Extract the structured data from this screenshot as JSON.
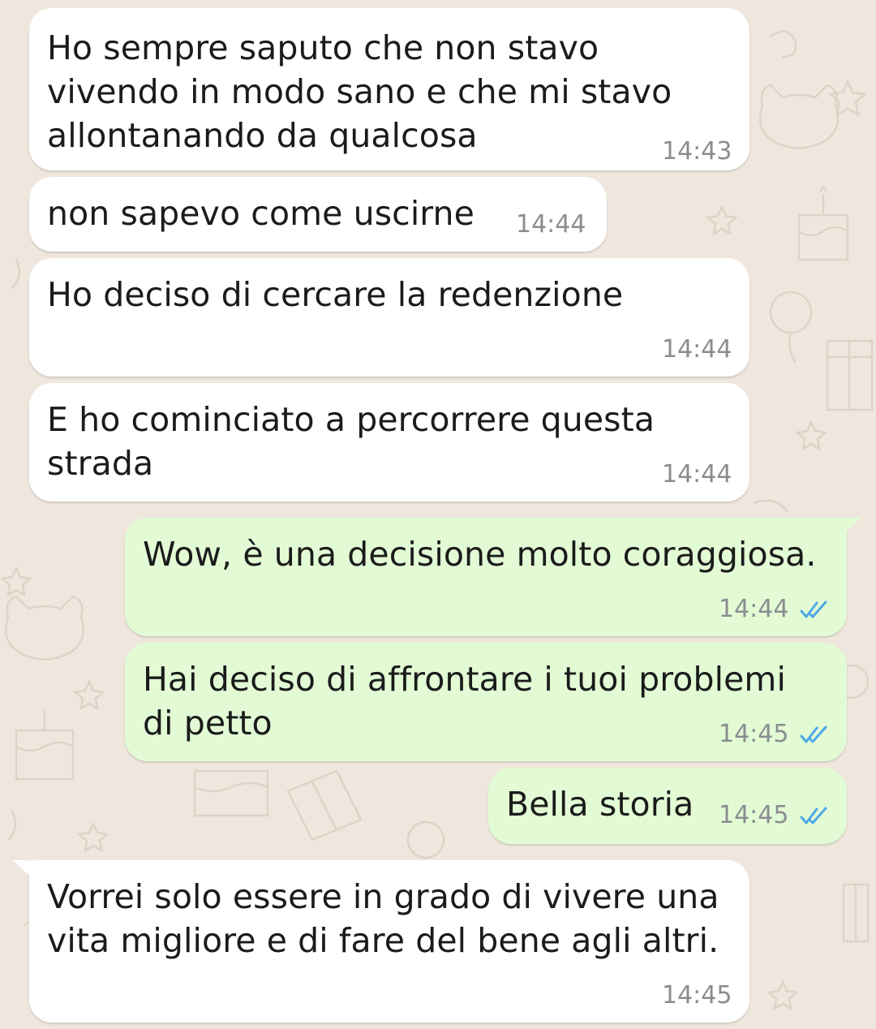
{
  "messages": [
    {
      "direction": "incoming",
      "text": "Ho sempre saputo che non stavo\nvivendo in modo sano e che mi stavo\nallontanando da qualcosa",
      "time": "14:43"
    },
    {
      "direction": "incoming",
      "text": "non sapevo come uscirne",
      "time": "14:44"
    },
    {
      "direction": "incoming",
      "text": "Ho deciso di cercare la redenzione",
      "time": "14:44"
    },
    {
      "direction": "incoming",
      "text": "E ho cominciato a percorrere questa\nstrada",
      "time": "14:44"
    },
    {
      "direction": "outgoing",
      "text": "Wow, è una decisione molto coraggiosa.",
      "time": "14:44",
      "status": "read"
    },
    {
      "direction": "outgoing",
      "text": "Hai deciso di affrontare i tuoi problemi\ndi petto",
      "time": "14:45",
      "status": "read"
    },
    {
      "direction": "outgoing",
      "text": "Bella storia",
      "time": "14:45",
      "status": "read"
    },
    {
      "direction": "incoming",
      "text": "Vorrei solo essere in grado di vivere una\nvita migliore e di fare del bene agli altri.",
      "time": "14:45"
    }
  ],
  "icons": {
    "read_status": "double-check-icon"
  },
  "colors": {
    "wallpaper": "#efe7dd",
    "incoming_bubble": "#ffffff",
    "outgoing_bubble": "#e2fbd5",
    "read_ticks": "#4fa8e6",
    "timestamp": "#8a8d8f"
  }
}
